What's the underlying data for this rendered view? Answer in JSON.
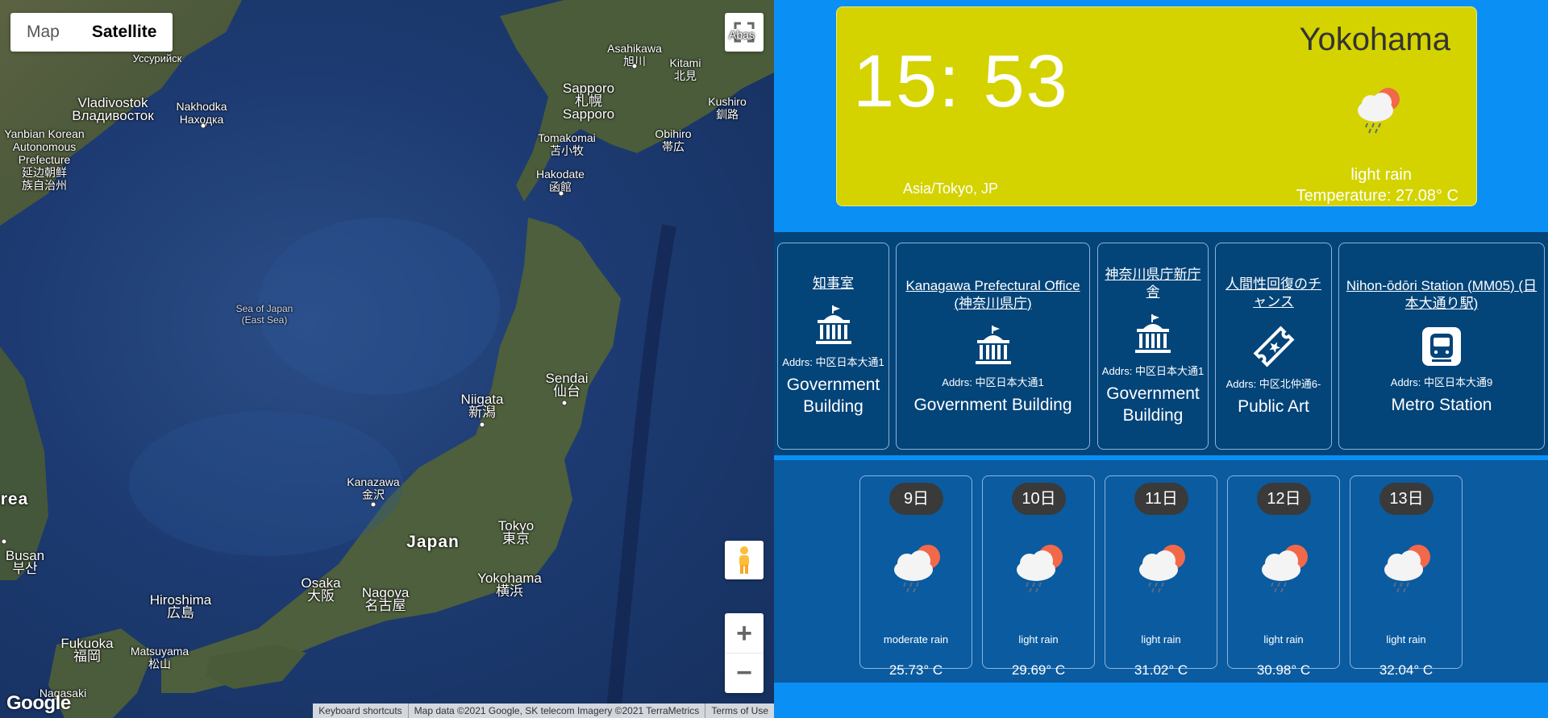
{
  "map": {
    "type_buttons": [
      "Map",
      "Satellite"
    ],
    "active_type": "Satellite",
    "labels": {
      "ussuriysk": "Уссурийск",
      "vladivostok": "Vladivostok",
      "vladivostok_ru": "Владивосток",
      "nakhodka": "Nakhodka",
      "nakhodka_ru": "Находка",
      "yanbian": "Yanbian Korean",
      "yanbian2": "Autonomous",
      "yanbian3": "Prefecture",
      "yanbian4": "延边朝鲜",
      "yanbian5": "族自治州",
      "asahikawa": "Asahikawa",
      "asahikawa_jp": "旭川",
      "kitami": "Kitami",
      "kitami_jp": "北見",
      "sapporo": "Sapporo",
      "sapporo_jp": "札幌",
      "sapporo2": "Sapporo",
      "kushiro": "Kushiro",
      "kushiro_jp": "釧路",
      "tomakomai": "Tomakomai",
      "tomakomai_jp": "苫小牧",
      "obihiro": "Obihiro",
      "obihiro_jp": "帯広",
      "hakodate": "Hakodate",
      "hakodate_jp": "函館",
      "sea": "Sea of Japan",
      "sea2": "(East Sea)",
      "niigata": "Niigata",
      "niigata_jp": "新潟",
      "sendai": "Sendai",
      "sendai_jp": "仙台",
      "kanazawa": "Kanazawa",
      "kanazawa_jp": "金沢",
      "japan": "Japan",
      "tokyo": "Tokyo",
      "tokyo_jp": "東京",
      "yokohama": "Yokohama",
      "yokohama_jp": "横浜",
      "nagoya": "Nagoya",
      "nagoya_jp": "名古屋",
      "osaka": "Osaka",
      "osaka_jp": "大阪",
      "hiroshima": "Hiroshima",
      "hiroshima_jp": "広島",
      "busan": "Busan",
      "busan_kr": "부산",
      "korea": "rea",
      "fukuoka": "Fukuoka",
      "fukuoka_jp": "福岡",
      "matsuyama": "Matsuyama",
      "matsuyama_jp": "松山",
      "nagasaki": "Nagasaki",
      "abas": "Abas"
    },
    "logo": "Google",
    "attribution": [
      "Keyboard shortcuts",
      "Map data ©2021 Google, SK telecom Imagery ©2021 TerraMetrics",
      "Terms of Use"
    ],
    "zoom_in": "+",
    "zoom_out": "−"
  },
  "clock": {
    "time": "15: 53",
    "city": "Yokohama",
    "timezone": "Asia/Tokyo, JP",
    "description": "light rain",
    "temperature": "Temperature: 27.08° C",
    "icon": "cloud-sun-rain-icon"
  },
  "places": [
    {
      "name": "知事室",
      "addr": "Addrs: 中区日本大通1",
      "type": "Government Building",
      "icon": "government-building-icon"
    },
    {
      "name": "Kanagawa Prefectural Office (神奈川県庁)",
      "addr": "Addrs: 中区日本大通1",
      "type": "Government Building",
      "icon": "government-building-icon"
    },
    {
      "name": "神奈川県庁新庁舎",
      "addr": "Addrs: 中区日本大通1",
      "type": "Government Building",
      "icon": "government-building-icon"
    },
    {
      "name": "人間性回復のチャンス",
      "addr": "Addrs: 中区北仲通6-",
      "type": "Public Art",
      "icon": "ticket-icon"
    },
    {
      "name": "Nihon-ōdōri Station (MM05) (日本大通り駅)",
      "addr": "Addrs: 中区日本大通9",
      "type": "Metro Station",
      "icon": "metro-icon"
    }
  ],
  "forecast": [
    {
      "day": "9日",
      "desc": "moderate rain",
      "temp": "25.73° C"
    },
    {
      "day": "10日",
      "desc": "light rain",
      "temp": "29.69° C"
    },
    {
      "day": "11日",
      "desc": "light rain",
      "temp": "31.02° C"
    },
    {
      "day": "12日",
      "desc": "light rain",
      "temp": "30.98° C"
    },
    {
      "day": "13日",
      "desc": "light rain",
      "temp": "32.04° C"
    }
  ],
  "colors": {
    "panel_bg": "#0a8ff5",
    "clock_bg": "#d4d300",
    "places_bg": "#034479",
    "forecast_bg": "#0a5ba0"
  }
}
